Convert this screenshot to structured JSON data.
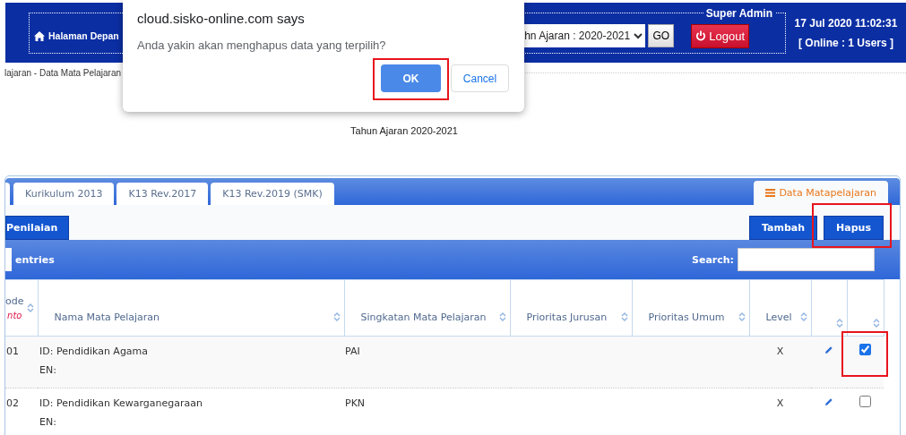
{
  "header": {
    "home_link": "Halaman Depan",
    "role": "Super Admin",
    "year_select": "hn Ajaran : 2020-2021",
    "go_button": "GO",
    "logout_button": "Logout",
    "datetime": "17 Jul 2020 11:02:31",
    "online": "[ Online : 1 Users ]"
  },
  "breadcrumb": "lajaran - Data Mata Pelajaran",
  "subtitle": "Tahun Ajaran 2020-2021",
  "tabs": [
    {
      "label": "Kurikulum 2013",
      "selected": false
    },
    {
      "label": "K13 Rev.2017",
      "selected": false
    },
    {
      "label": "K13 Rev.2019 (SMK)",
      "selected": false
    },
    {
      "label": "Data Matapelajaran",
      "selected": true
    }
  ],
  "toolbar": {
    "left_button": "Penilaian",
    "right_buttons": [
      {
        "label": "Tambah",
        "highlighted": false
      },
      {
        "label": "Hapus",
        "highlighted": true
      }
    ]
  },
  "table_controls": {
    "entries_label": "entries",
    "search_label": "Search:"
  },
  "columns": [
    {
      "label": "ode",
      "note": "nto"
    },
    {
      "label": "Nama Mata Pelajaran"
    },
    {
      "label": "Singkatan Mata Pelajaran"
    },
    {
      "label": "Prioritas Jurusan"
    },
    {
      "label": "Prioritas Umum"
    },
    {
      "label": "Level"
    }
  ],
  "rows": [
    {
      "code": "01",
      "name_id": "ID: Pendidikan Agama",
      "name_en": "EN:",
      "abbr": "PAI",
      "level": "X",
      "checked": true,
      "highlighted": true
    },
    {
      "code": "02",
      "name_id": "ID: Pendidikan Kewarganegaraan",
      "name_en": "EN:",
      "abbr": "PKN",
      "level": "X",
      "checked": false,
      "highlighted": false
    }
  ],
  "dialog": {
    "title": "cloud.sisko-online.com says",
    "message": "Anda yakin akan menghapus data yang terpilih?",
    "ok_button": "OK",
    "cancel_button": "Cancel",
    "ok_highlighted": true
  }
}
